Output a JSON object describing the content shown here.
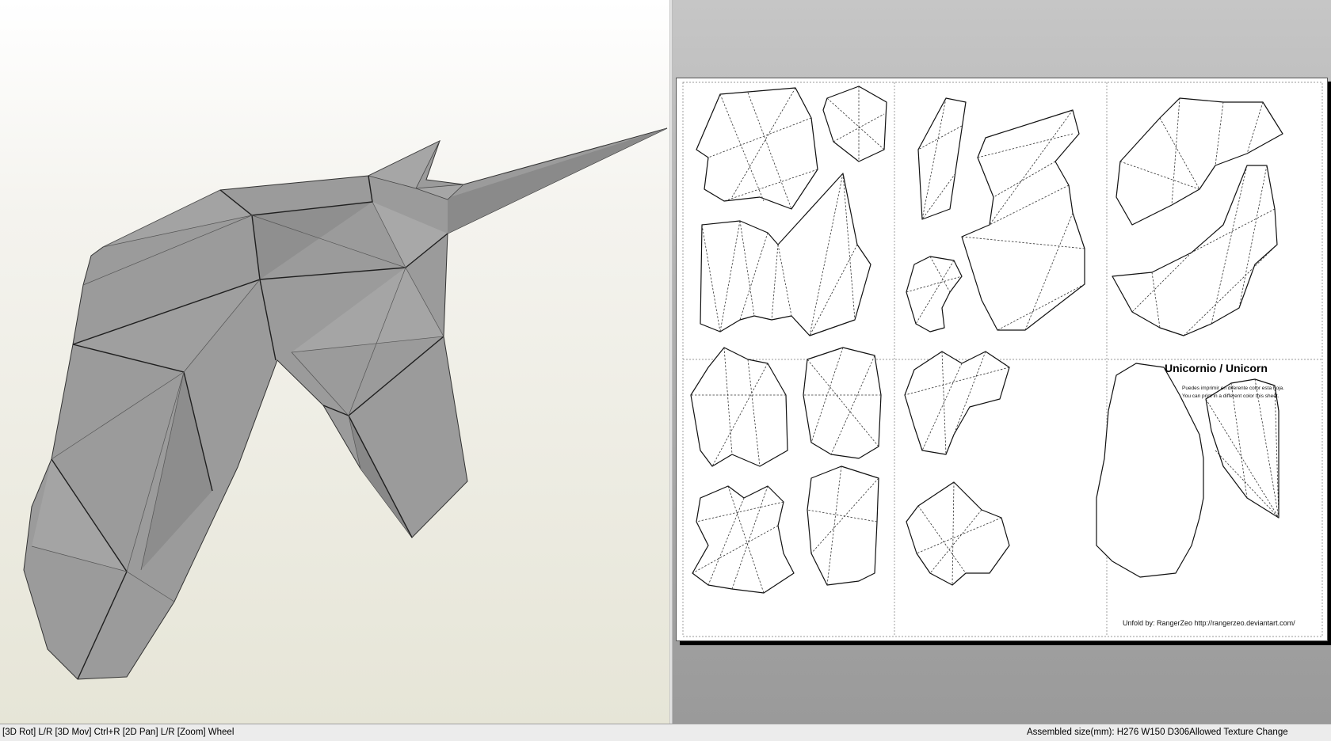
{
  "statusbar": {
    "help_text": "[3D Rot] L/R [3D Mov] Ctrl+R [2D Pan] L/R [Zoom] Wheel",
    "assembled_size": "Assembled size(mm): H276 W150 D306",
    "texture_mode": "Allowed Texture Change"
  },
  "sheet": {
    "title": "Unicornio / Unicorn",
    "note_es": "Puedes imprimir en diferente color esta hoja.",
    "note_en": "You can print in a different color this sheet.",
    "credit": "Unfold by: RangerZeo http://rangerzeo.deviantart.com/"
  },
  "colors": {
    "model_fill": "#9a9a9a",
    "model_edge": "#222222",
    "sheet_background": "#ffffff",
    "workspace_background": "#b0b0b0"
  }
}
